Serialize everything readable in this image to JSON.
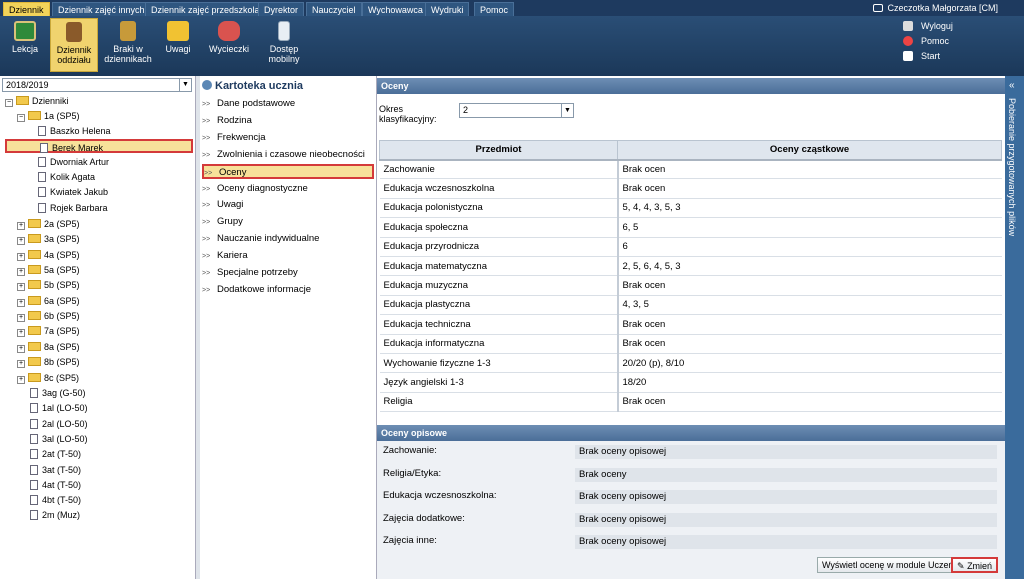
{
  "topnav": {
    "tabs": [
      "Dziennik",
      "Dziennik zajęć innych",
      "Dziennik zajęć przedszkola",
      "Dyrektor",
      "Nauczyciel",
      "Wychowawca",
      "Wydruki",
      "Pomoc"
    ],
    "active_tab": "Dziennik",
    "user": "Czeczotka Małgorzata [CM]"
  },
  "ribbon": {
    "buttons": [
      {
        "label": "Lekcja",
        "icon": "lesson-board-icon"
      },
      {
        "label": "Dziennik oddziału",
        "icon": "class-journal-icon"
      },
      {
        "label": "Braki w dziennikach",
        "icon": "missing-entries-icon"
      },
      {
        "label": "Uwagi",
        "icon": "warning-icon"
      },
      {
        "label": "Wycieczki",
        "icon": "backpack-icon"
      },
      {
        "label": "Dostęp mobilny",
        "icon": "mobile-phone-icon"
      }
    ],
    "active_button": "Dziennik oddziału",
    "links": [
      "Wyloguj",
      "Pomoc",
      "Start"
    ]
  },
  "tree": {
    "year": "2018/2019",
    "root": "Dzienniki",
    "expanded": "1a (SP5)",
    "students": [
      "Baszko Helena",
      "Berek Marek",
      "Dworniak Artur",
      "Kolik Agata",
      "Kwiatek Jakub",
      "Rojek Barbara"
    ],
    "selected": "Berek Marek",
    "classes": [
      "2a (SP5)",
      "3a (SP5)",
      "4a (SP5)",
      "5a (SP5)",
      "5b (SP5)",
      "6a (SP5)",
      "6b (SP5)",
      "7a (SP5)",
      "8a (SP5)",
      "8b (SP5)",
      "8c (SP5)"
    ],
    "journals": [
      "3ag (G-50)",
      "1al (LO-50)",
      "2al (LO-50)",
      "3al (LO-50)",
      "2at (T-50)",
      "3at (T-50)",
      "4at (T-50)",
      "4bt (T-50)",
      "2m (Muz)"
    ]
  },
  "kartoteka": {
    "title": "Kartoteka ucznia",
    "items": [
      "Dane podstawowe",
      "Rodzina",
      "Frekwencja",
      "Zwolnienia i czasowe nieobecności",
      "Oceny",
      "Oceny diagnostyczne",
      "Uwagi",
      "Grupy",
      "Nauczanie indywidualne",
      "Kariera",
      "Specjalne potrzeby",
      "Dodatkowe informacje"
    ],
    "selected": "Oceny"
  },
  "oceny": {
    "header": "Oceny",
    "okres_label": "Okres klasyfikacyjny:",
    "okres_value": "2",
    "col_subject": "Przedmiot",
    "col_grades": "Oceny cząstkowe",
    "rows": [
      [
        "Zachowanie",
        "Brak ocen"
      ],
      [
        "Edukacja wczesnoszkolna",
        "Brak ocen"
      ],
      [
        "Edukacja polonistyczna",
        "5, 4, 4, 3, 5, 3"
      ],
      [
        "Edukacja społeczna",
        "6, 5"
      ],
      [
        "Edukacja przyrodnicza",
        "6"
      ],
      [
        "Edukacja matematyczna",
        "2, 5, 6, 4, 5, 3"
      ],
      [
        "Edukacja muzyczna",
        "Brak ocen"
      ],
      [
        "Edukacja plastyczna",
        "4, 3, 5"
      ],
      [
        "Edukacja techniczna",
        "Brak ocen"
      ],
      [
        "Edukacja informatyczna",
        "Brak ocen"
      ],
      [
        "Wychowanie fizyczne 1-3",
        "20/20 (p), 8/10"
      ],
      [
        "Język angielski 1-3",
        "18/20"
      ],
      [
        "Religia",
        "Brak ocen"
      ]
    ]
  },
  "opisowe": {
    "header": "Oceny opisowe",
    "rows": [
      [
        "Zachowanie:",
        "Brak oceny opisowej"
      ],
      [
        "Religia/Etyka:",
        "Brak oceny"
      ],
      [
        "Edukacja wczesnoszkolna:",
        "Brak oceny opisowej"
      ],
      [
        "Zajęcia dodatkowe:",
        "Brak oceny opisowej"
      ],
      [
        "Zajęcia inne:",
        "Brak oceny opisowej"
      ]
    ],
    "btn_show": "Wyświetl ocenę w module Uczeń",
    "btn_change": "Zmień"
  },
  "sidepanel": {
    "label": "Pobieranie przygotowanych plików"
  },
  "colors": {
    "nav": "#1e3a5f",
    "active": "#f2d35a",
    "highlight_border": "#d43a3a"
  }
}
